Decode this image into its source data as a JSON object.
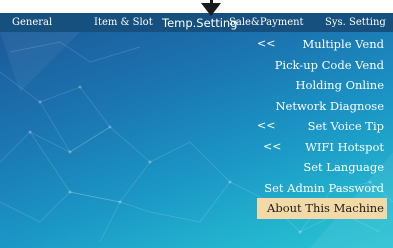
{
  "tabs": {
    "general": "General",
    "item_slot": "Item & Slot",
    "temp_setting": "Temp.Setting",
    "sale_payment": "Sale&Payment",
    "sys_setting": "Sys. Setting"
  },
  "menu": {
    "multiple_vend": {
      "label": "Multiple Vend",
      "arrow": "<<"
    },
    "pickup_code_vend": {
      "label": "Pick-up Code Vend"
    },
    "holding_online": {
      "label": "Holding Online"
    },
    "network_diagnose": {
      "label": "Network Diagnose"
    },
    "set_voice_tip": {
      "label": "Set Voice Tip",
      "arrow": "<<"
    },
    "wifi_hotspot": {
      "label": "WIFI Hotspot",
      "arrow": "<<"
    },
    "set_language": {
      "label": "Set Language"
    },
    "set_admin_password": {
      "label": "Set Admin Password"
    },
    "about_this_machine": {
      "label": "About This Machine"
    }
  },
  "colors": {
    "tabbar": "#15507f",
    "selected_item_bg": "#f3d9a7",
    "accent": "#1b97c6"
  }
}
